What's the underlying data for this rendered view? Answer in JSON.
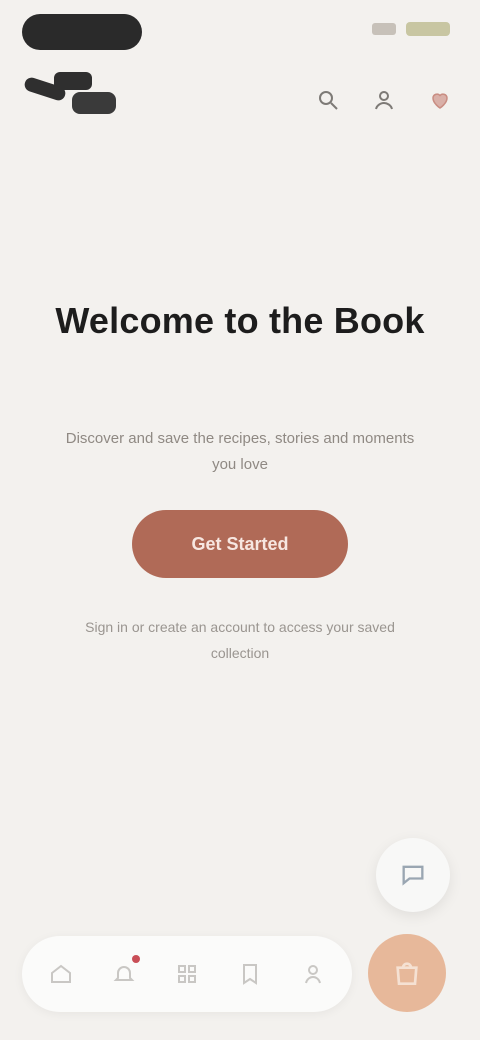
{
  "brand": {
    "logo_icon": "brand-logo-icon"
  },
  "status": {
    "signal_icon": "signal-icon",
    "battery_icon": "battery-icon"
  },
  "header": {
    "icons": [
      "search-icon",
      "account-icon",
      "heart-icon"
    ]
  },
  "hero": {
    "title": "Welcome to the Book",
    "subtitle": "Discover and save the recipes, stories and moments you love",
    "cta_label": "Get Started",
    "note": "Sign in or create an account to access your saved collection"
  },
  "fab": {
    "icon": "chat-icon"
  },
  "bottom_nav": {
    "items": [
      {
        "icon": "home-icon",
        "badge": false
      },
      {
        "icon": "bell-icon",
        "badge": true
      },
      {
        "icon": "grid-icon",
        "badge": false
      },
      {
        "icon": "bookmark-icon",
        "badge": false
      },
      {
        "icon": "profile-icon",
        "badge": false
      }
    ],
    "cart_icon": "shopping-bag-icon"
  },
  "colors": {
    "background": "#f3f1ee",
    "accent": "#b06a57",
    "cart": "#e7b89a",
    "badge": "#c94e57"
  }
}
